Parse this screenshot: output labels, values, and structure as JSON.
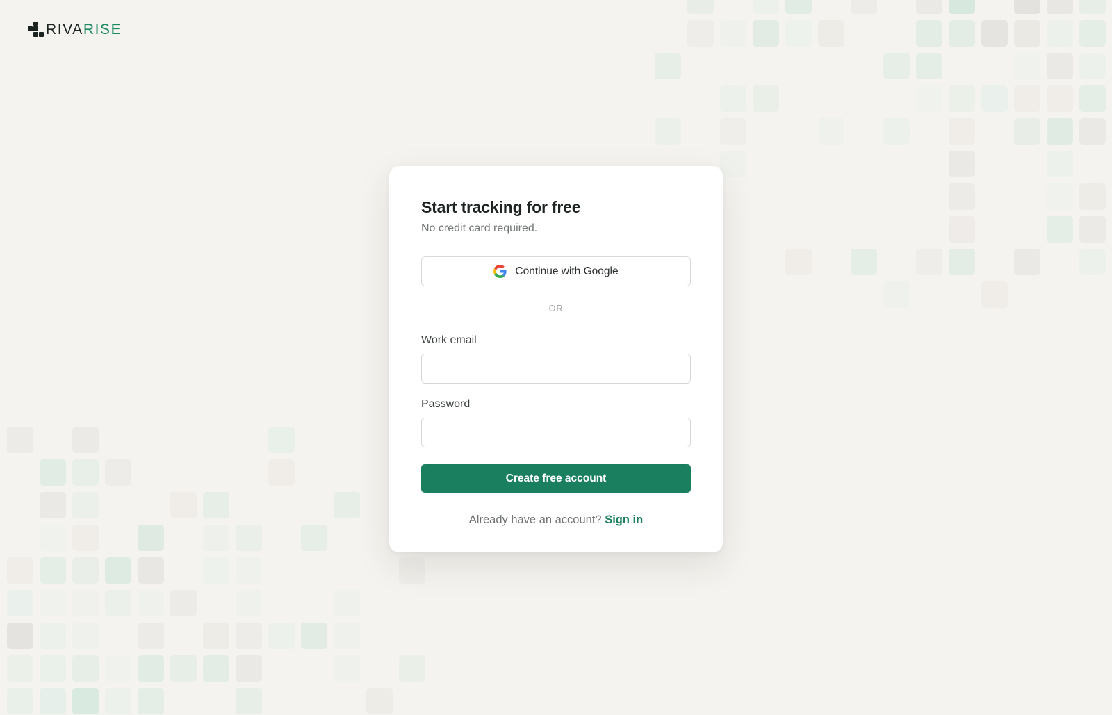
{
  "brand": {
    "name_dark": "RIVA",
    "name_accent": "RISE",
    "accent_color": "#1a8a5e",
    "dark_color": "#1a2320"
  },
  "signup_card": {
    "title": "Start tracking for free",
    "subtitle": "No credit card required.",
    "google_button_label": "Continue with Google",
    "google_icon": "google-g-icon",
    "divider_label": "OR",
    "email_label": "Work email",
    "email_value": "",
    "password_label": "Password",
    "password_value": "",
    "submit_label": "Create free account",
    "signin_prompt": "Already have an account?",
    "signin_link_label": "Sign in",
    "primary_color": "#1a7f5f"
  },
  "background": {
    "pattern": "grid-tiles",
    "tile_colors": [
      "#cfe6da",
      "#e2e0dc",
      "#e4efe8"
    ]
  }
}
